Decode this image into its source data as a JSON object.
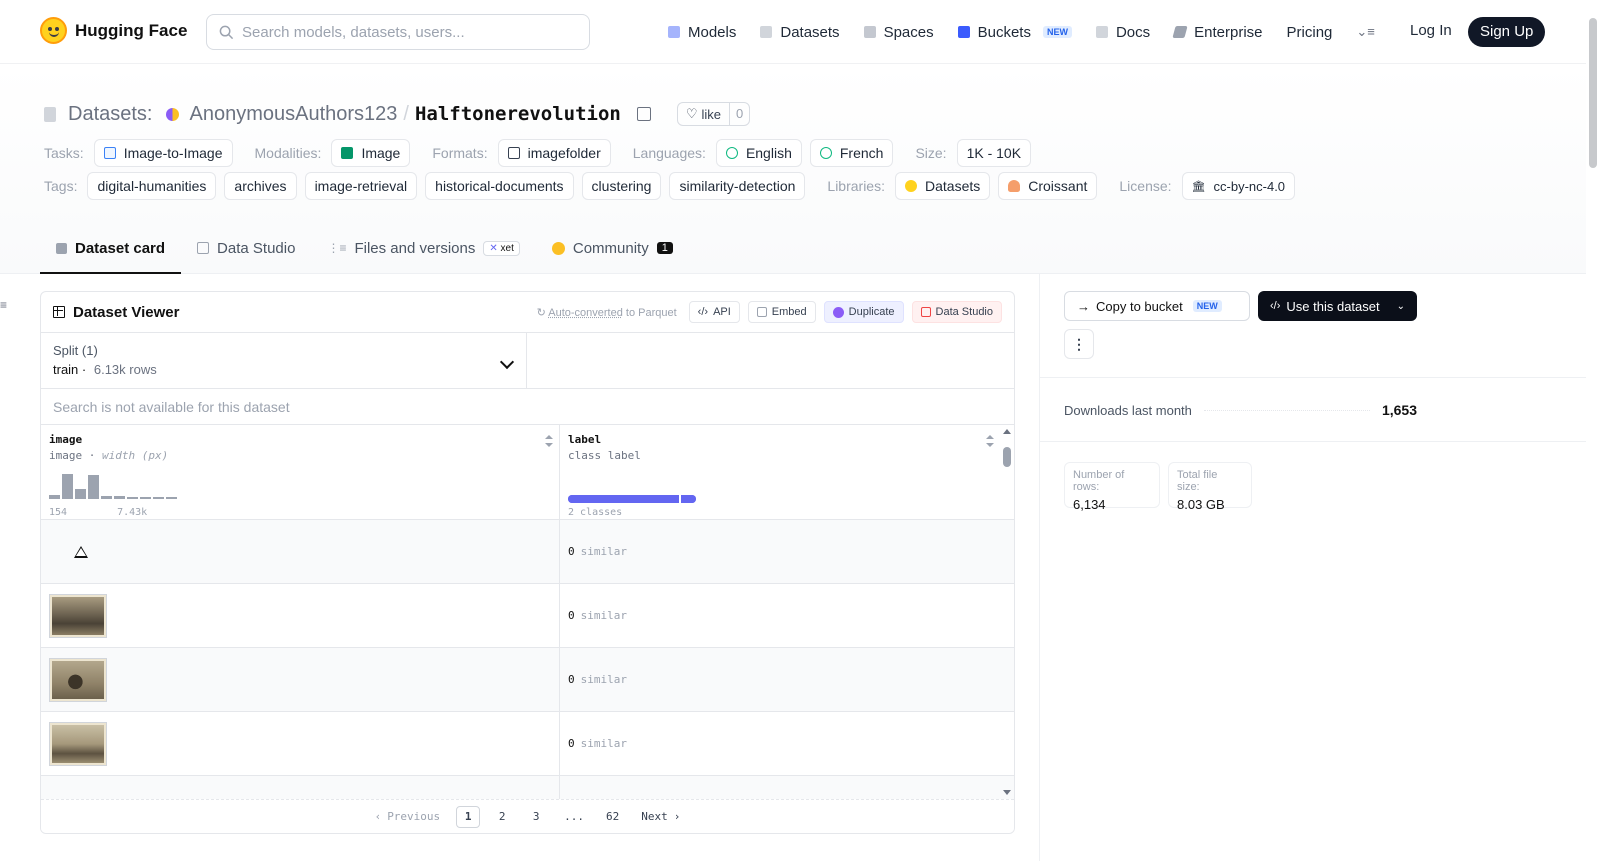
{
  "nav": {
    "brand": "Hugging Face",
    "search_placeholder": "Search models, datasets, users...",
    "links": [
      "Models",
      "Datasets",
      "Spaces",
      "Buckets",
      "Docs",
      "Enterprise",
      "Pricing"
    ],
    "buckets_badge": "NEW",
    "login": "Log In",
    "signup": "Sign Up"
  },
  "header": {
    "section": "Datasets:",
    "owner": "AnonymousAuthors123",
    "slash": "/",
    "name": "Halftonerevolution",
    "like_label": "like",
    "like_count": "0",
    "tasks_label": "Tasks:",
    "task": "Image-to-Image",
    "modalities_label": "Modalities:",
    "modality": "Image",
    "formats_label": "Formats:",
    "format": "imagefolder",
    "languages_label": "Languages:",
    "languages": [
      "English",
      "French"
    ],
    "size_label": "Size:",
    "size": "1K - 10K",
    "tags_label": "Tags:",
    "tags": [
      "digital-humanities",
      "archives",
      "image-retrieval",
      "historical-documents",
      "clustering",
      "similarity-detection"
    ],
    "libraries_label": "Libraries:",
    "libraries": [
      "Datasets",
      "Croissant"
    ],
    "license_label": "License:",
    "license": "cc-by-nc-4.0"
  },
  "tabs": {
    "dataset_card": "Dataset card",
    "data_studio": "Data Studio",
    "files": "Files and versions",
    "xet": "xet",
    "community": "Community",
    "community_count": "1"
  },
  "viewer": {
    "title": "Dataset Viewer",
    "auto_converted": "Auto-converted",
    "to_parquet": "to Parquet",
    "btn_api": "API",
    "btn_embed": "Embed",
    "btn_duplicate": "Duplicate",
    "btn_data_studio": "Data Studio",
    "split_label": "Split (1)",
    "split_name": "train",
    "split_rows": "6.13k rows",
    "search_na": "Search is not available for this dataset",
    "col1_name": "image",
    "col1_type": "image",
    "col1_sub": "width (px)",
    "col1_min": "154",
    "col1_max": "7.43k",
    "col1_hist": [
      0.15,
      0.95,
      0.4,
      0.92,
      0.12,
      0.1,
      0.05,
      0.05,
      0.05,
      0.05
    ],
    "col2_name": "label",
    "col2_type": "class label",
    "col2_classes": "2 classes",
    "class_split": [
      0.87,
      0.13
    ],
    "rows": [
      {
        "value": "0",
        "label": "similar"
      },
      {
        "value": "0",
        "label": "similar"
      },
      {
        "value": "0",
        "label": "similar"
      },
      {
        "value": "0",
        "label": "similar"
      }
    ],
    "pager": {
      "prev": "Previous",
      "pages": [
        "1",
        "2",
        "3",
        "...",
        "62"
      ],
      "next": "Next"
    }
  },
  "sidebar": {
    "copy_bucket": "Copy to bucket",
    "copy_badge": "NEW",
    "use_dataset": "Use this dataset",
    "downloads_label": "Downloads last month",
    "downloads_value": "1,653",
    "rows_label": "Number of rows:",
    "rows_value": "6,134",
    "size_label": "Total file size:",
    "size_value": "8.03 GB"
  },
  "colors": {
    "accent_indigo": "#6366f1",
    "brand_yellow": "#ffd21e",
    "dark_button": "#0b0f19"
  }
}
